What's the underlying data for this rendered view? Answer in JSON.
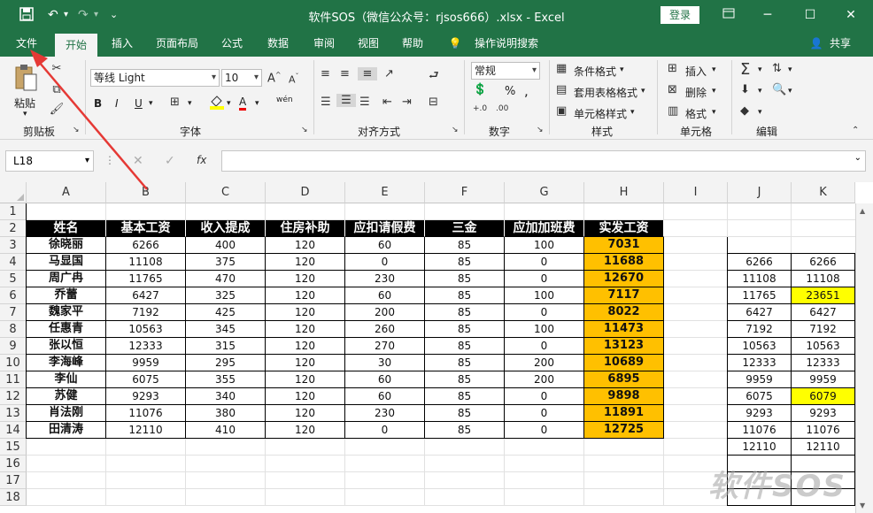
{
  "window": {
    "title": "软件SOS（微信公众号：rjsos666）.xlsx  -  Excel",
    "login_label": "登录"
  },
  "quick_access": {
    "save_icon": "save-icon",
    "undo_icon": "undo-icon",
    "redo_icon": "redo-icon",
    "customize_icon": "customize-icon"
  },
  "tabs": [
    {
      "label": "文件"
    },
    {
      "label": "开始"
    },
    {
      "label": "插入"
    },
    {
      "label": "页面布局"
    },
    {
      "label": "公式"
    },
    {
      "label": "数据"
    },
    {
      "label": "审阅"
    },
    {
      "label": "视图"
    },
    {
      "label": "帮助"
    },
    {
      "label": "操作说明搜索"
    },
    {
      "label": "共享"
    }
  ],
  "ribbon": {
    "clipboard": {
      "paste": "粘贴",
      "group": "剪贴板"
    },
    "font": {
      "name": "等线 Light",
      "size": "10",
      "bold": "B",
      "italic": "I",
      "underline": "U",
      "font_color": "A",
      "phonetic": "wén",
      "group": "字体"
    },
    "alignment": {
      "group": "对齐方式"
    },
    "number": {
      "format": "常规",
      "percent": "%",
      "comma": ",",
      "group": "数字"
    },
    "styles": {
      "conditional": "条件格式",
      "table": "套用表格格式",
      "cell": "单元格样式",
      "group": "样式"
    },
    "cells": {
      "insert": "插入",
      "delete": "删除",
      "format": "格式",
      "group": "单元格"
    },
    "editing": {
      "group": "编辑"
    }
  },
  "formula_bar": {
    "name_box": "L18",
    "fx": "fx"
  },
  "columns": [
    "A",
    "B",
    "C",
    "D",
    "E",
    "F",
    "G",
    "H",
    "I",
    "J",
    "K"
  ],
  "rows": [
    "1",
    "2",
    "3",
    "4",
    "5",
    "6",
    "7",
    "8",
    "9",
    "10",
    "11",
    "12",
    "13",
    "14",
    "15",
    "16",
    "17",
    "18"
  ],
  "table": {
    "headers": [
      "姓名",
      "基本工资",
      "收入提成",
      "住房补助",
      "应扣请假费",
      "三金",
      "应加加班费",
      "实发工资"
    ],
    "rows": [
      [
        "徐晓丽",
        "6266",
        "400",
        "120",
        "60",
        "85",
        "100",
        "7031"
      ],
      [
        "马显国",
        "11108",
        "375",
        "120",
        "0",
        "85",
        "0",
        "11688"
      ],
      [
        "周广冉",
        "11765",
        "470",
        "120",
        "230",
        "85",
        "0",
        "12670"
      ],
      [
        "乔蕾",
        "6427",
        "325",
        "120",
        "60",
        "85",
        "100",
        "7117"
      ],
      [
        "魏家平",
        "7192",
        "425",
        "120",
        "200",
        "85",
        "0",
        "8022"
      ],
      [
        "任惠青",
        "10563",
        "345",
        "120",
        "260",
        "85",
        "100",
        "11473"
      ],
      [
        "张以恒",
        "12333",
        "315",
        "120",
        "270",
        "85",
        "0",
        "13123"
      ],
      [
        "李海峰",
        "9959",
        "295",
        "120",
        "30",
        "85",
        "200",
        "10689"
      ],
      [
        "李仙",
        "6075",
        "355",
        "120",
        "60",
        "85",
        "200",
        "6895"
      ],
      [
        "苏健",
        "9293",
        "340",
        "120",
        "60",
        "85",
        "0",
        "9898"
      ],
      [
        "肖法刚",
        "11076",
        "380",
        "120",
        "230",
        "85",
        "0",
        "11891"
      ],
      [
        "田清涛",
        "12110",
        "410",
        "120",
        "0",
        "85",
        "0",
        "12725"
      ]
    ]
  },
  "side_table": {
    "J": [
      "6266",
      "11108",
      "11765",
      "6427",
      "7192",
      "10563",
      "12333",
      "9959",
      "6075",
      "9293",
      "11076",
      "12110"
    ],
    "K": [
      "6266",
      "11108",
      "23651",
      "6427",
      "7192",
      "10563",
      "12333",
      "9959",
      "6079",
      "9293",
      "11076",
      "12110"
    ]
  },
  "colors": {
    "brand": "#217346",
    "header_bg": "#000000",
    "total_bg": "#ffc000",
    "mismatch_bg": "#ffff00",
    "arrow": "#e53935"
  },
  "watermark": "软件SOS"
}
